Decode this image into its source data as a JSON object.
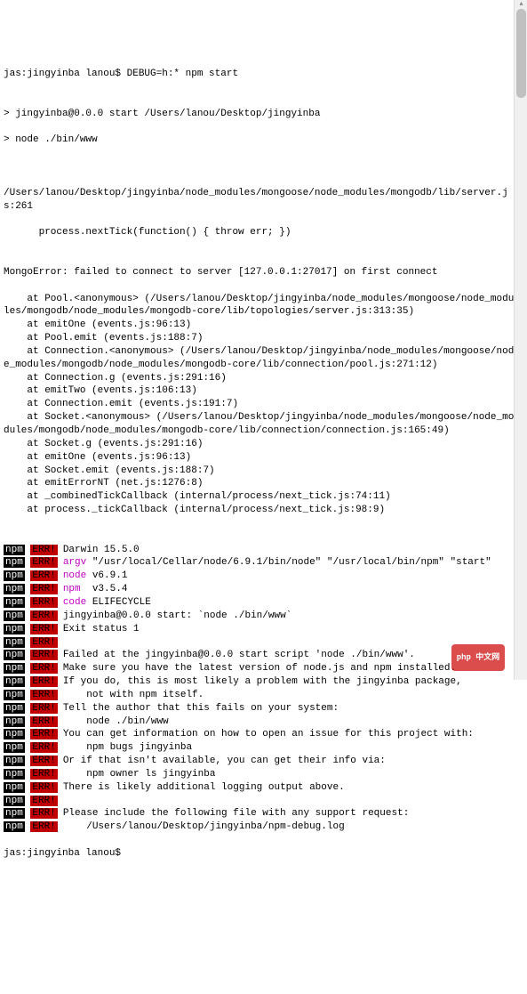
{
  "prompt1": "jas:jingyinba lanou$ DEBUG=h:* npm start",
  "blank": "",
  "startLine1": "> jingyinba@0.0.0 start /Users/lanou/Desktop/jingyinba",
  "startLine2": "> node ./bin/www",
  "stackPath1": "/Users/lanou/Desktop/jingyinba/node_modules/mongoose/node_modules/mongodb/lib/server.js:261",
  "stackCode1": "      process.nextTick(function() { throw err; })",
  "errorHeader": "MongoError: failed to connect to server [127.0.0.1:27017] on first connect",
  "trace": [
    "    at Pool.<anonymous> (/Users/lanou/Desktop/jingyinba/node_modules/mongoose/node_modules/mongodb/node_modules/mongodb-core/lib/topologies/server.js:313:35)",
    "    at emitOne (events.js:96:13)",
    "    at Pool.emit (events.js:188:7)",
    "    at Connection.<anonymous> (/Users/lanou/Desktop/jingyinba/node_modules/mongoose/node_modules/mongodb/node_modules/mongodb-core/lib/connection/pool.js:271:12)",
    "    at Connection.g (events.js:291:16)",
    "    at emitTwo (events.js:106:13)",
    "    at Connection.emit (events.js:191:7)",
    "    at Socket.<anonymous> (/Users/lanou/Desktop/jingyinba/node_modules/mongoose/node_modules/mongodb/node_modules/mongodb-core/lib/connection/connection.js:165:49)",
    "    at Socket.g (events.js:291:16)",
    "    at emitOne (events.js:96:13)",
    "    at Socket.emit (events.js:188:7)",
    "    at emitErrorNT (net.js:1276:8)",
    "    at _combinedTickCallback (internal/process/next_tick.js:74:11)",
    "    at process._tickCallback (internal/process/next_tick.js:98:9)"
  ],
  "npmBadge": "npm",
  "errBadge": "ERR!",
  "errLines": [
    {
      "key": "",
      "val": "Darwin 15.5.0"
    },
    {
      "key": "argv",
      "val": "\"/usr/local/Cellar/node/6.9.1/bin/node\" \"/usr/local/bin/npm\" \"start\""
    },
    {
      "key": "node",
      "val": "v6.9.1"
    },
    {
      "key": "npm ",
      "val": "v3.5.4"
    },
    {
      "key": "code",
      "val": "ELIFECYCLE"
    },
    {
      "key": "",
      "val": "jingyinba@0.0.0 start: `node ./bin/www`"
    },
    {
      "key": "",
      "val": "Exit status 1"
    },
    {
      "key": "",
      "val": ""
    },
    {
      "key": "",
      "val": "Failed at the jingyinba@0.0.0 start script 'node ./bin/www'."
    },
    {
      "key": "",
      "val": "Make sure you have the latest version of node.js and npm installed."
    },
    {
      "key": "",
      "val": "If you do, this is most likely a problem with the jingyinba package,"
    },
    {
      "key": "",
      "val": "    not with npm itself."
    },
    {
      "key": "",
      "val": "Tell the author that this fails on your system:"
    },
    {
      "key": "",
      "val": "    node ./bin/www"
    },
    {
      "key": "",
      "val": "You can get information on how to open an issue for this project with:"
    },
    {
      "key": "",
      "val": "    npm bugs jingyinba"
    },
    {
      "key": "",
      "val": "Or if that isn't available, you can get their info via:"
    },
    {
      "key": "",
      "val": "    npm owner ls jingyinba"
    },
    {
      "key": "",
      "val": "There is likely additional logging output above."
    },
    {
      "key": "",
      "val": ""
    },
    {
      "key": "",
      "val": "Please include the following file with any support request:"
    },
    {
      "key": "",
      "val": "    /Users/lanou/Desktop/jingyinba/npm-debug.log"
    }
  ],
  "prompt2": "jas:jingyinba lanou$",
  "watermark": "php 中文网"
}
